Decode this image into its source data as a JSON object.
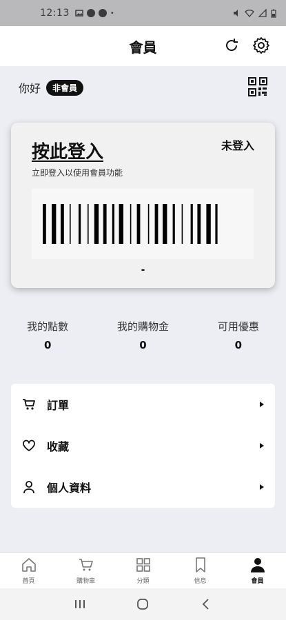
{
  "status_bar": {
    "time": "12:13"
  },
  "header": {
    "title": "會員"
  },
  "greeting": {
    "text": "你好",
    "badge": "非會員"
  },
  "card": {
    "login_title": "按此登入",
    "status": "未登入",
    "hint": "立即登入以使用會員功能",
    "code": "-"
  },
  "stats": [
    {
      "label": "我的點數",
      "value": "0"
    },
    {
      "label": "我的購物金",
      "value": "0"
    },
    {
      "label": "可用優惠",
      "value": "0"
    }
  ],
  "menu": [
    {
      "label": "訂單",
      "icon": "cart-icon"
    },
    {
      "label": "收藏",
      "icon": "heart-icon"
    },
    {
      "label": "個人資料",
      "icon": "person-icon"
    }
  ],
  "tabs": [
    {
      "label": "首頁",
      "icon": "home-icon",
      "active": false
    },
    {
      "label": "購物車",
      "icon": "cart-icon",
      "active": false
    },
    {
      "label": "分類",
      "icon": "grid-icon",
      "active": false
    },
    {
      "label": "信息",
      "icon": "bookmark-icon",
      "active": false
    },
    {
      "label": "會員",
      "icon": "person-icon",
      "active": true
    }
  ]
}
